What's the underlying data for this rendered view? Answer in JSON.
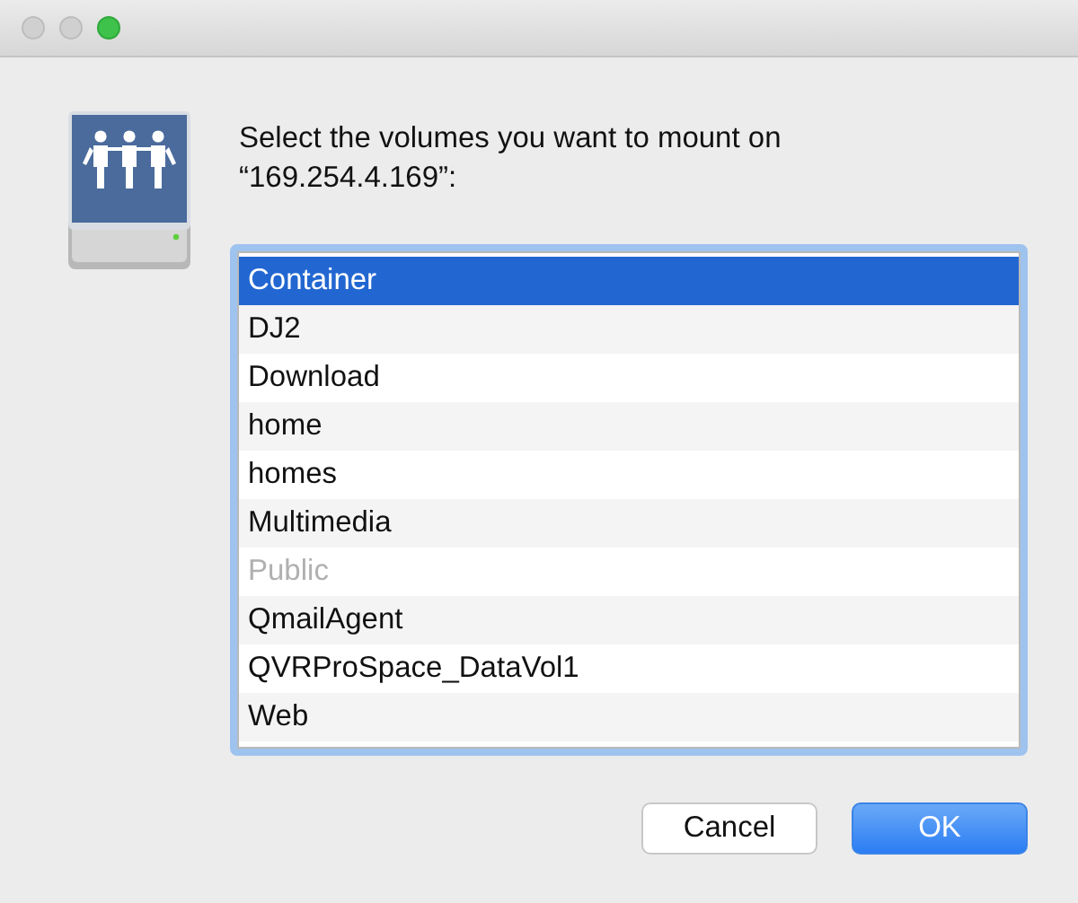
{
  "prompt": [
    "Select the volumes you want to mount on",
    "“169.254.4.169”:"
  ],
  "volumes": [
    {
      "name": "Container",
      "selected": true,
      "disabled": false
    },
    {
      "name": "DJ2",
      "selected": false,
      "disabled": false
    },
    {
      "name": "Download",
      "selected": false,
      "disabled": false
    },
    {
      "name": "home",
      "selected": false,
      "disabled": false
    },
    {
      "name": "homes",
      "selected": false,
      "disabled": false
    },
    {
      "name": "Multimedia",
      "selected": false,
      "disabled": false
    },
    {
      "name": "Public",
      "selected": false,
      "disabled": true
    },
    {
      "name": "QmailAgent",
      "selected": false,
      "disabled": false
    },
    {
      "name": "QVRProSpace_DataVol1",
      "selected": false,
      "disabled": false
    },
    {
      "name": "Web",
      "selected": false,
      "disabled": false
    }
  ],
  "buttons": [
    {
      "label": "Cancel",
      "kind": "secondary"
    },
    {
      "label": "OK",
      "kind": "default"
    }
  ]
}
